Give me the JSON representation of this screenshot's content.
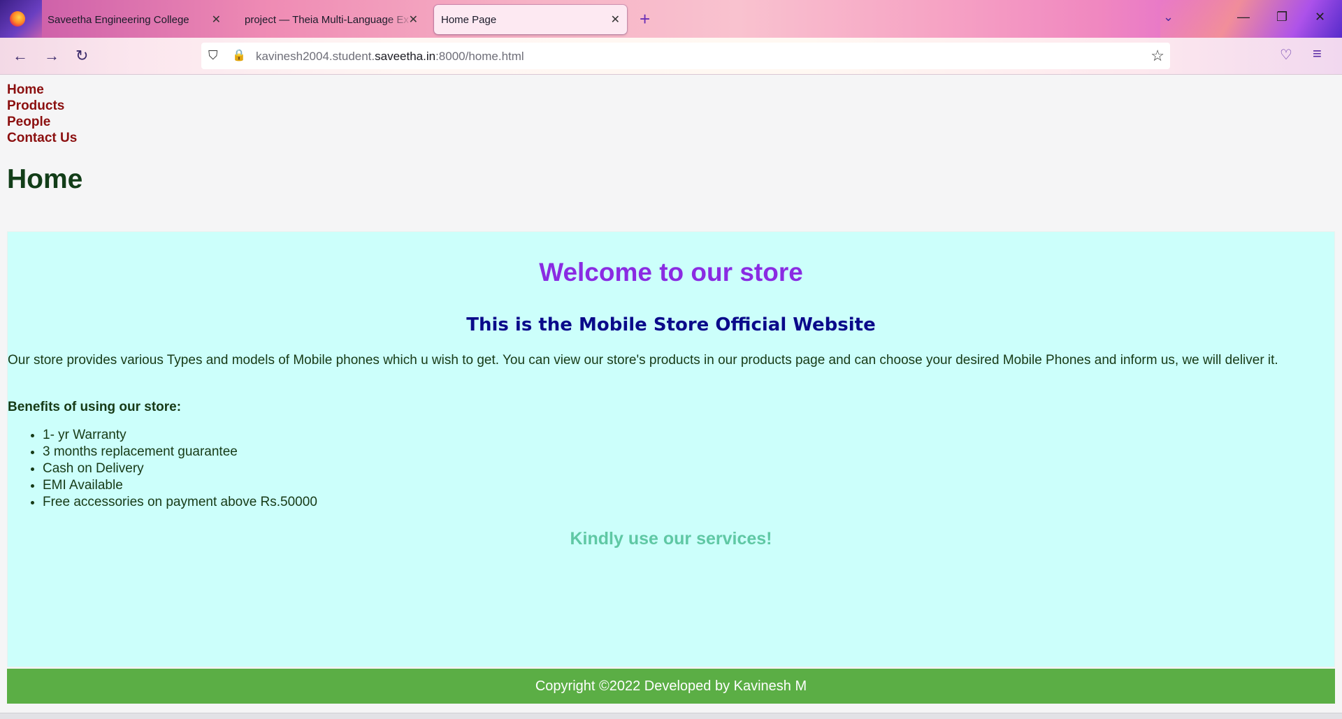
{
  "browser": {
    "tabs": [
      {
        "title": "Saveetha Engineering College",
        "active": false
      },
      {
        "title": "project — Theia Multi-Language Ex",
        "active": false
      },
      {
        "title": "Home Page",
        "active": true
      }
    ],
    "url": {
      "prefix": "kavinesh2004.student.",
      "domain": "saveetha.in",
      "suffix": ":8000/home.html"
    },
    "icons": {
      "back": "←",
      "forward": "→",
      "reload": "↻",
      "shield": "⛉",
      "lock": "🔒",
      "star": "☆",
      "pocket": "♡",
      "menu": "≡",
      "new_tab": "+",
      "list_tabs": "⌄",
      "minimize": "—",
      "maximize": "❐",
      "close": "✕",
      "tab_close": "✕"
    }
  },
  "site": {
    "nav": [
      "Home",
      "Products",
      "People",
      "Contact Us"
    ],
    "heading": "Home",
    "welcome": "Welcome to our store",
    "subtitle": "This is the Mobile Store Official Website",
    "description": "Our store provides various Types and models of Mobile phones which u wish to get. You can view our store's products in our products page and can choose your desired Mobile Phones and inform us, we will deliver it.",
    "benefits_heading": "Benefits of using our store:",
    "benefits": [
      "1- yr Warranty",
      "3 months replacement guarantee",
      "Cash on Delivery",
      "EMI Available",
      "Free accessories on payment above Rs.50000"
    ],
    "closing": "Kindly use our services!",
    "footer": "Copyright ©2022 Developed by Kavinesh M"
  },
  "colors": {
    "nav_link": "#8b0f0f",
    "heading": "#123d18",
    "content_bg": "#ccfffb",
    "welcome": "#8a2be2",
    "subtitle": "#0a0a8a",
    "closing": "#5fc8a4",
    "footer_bg": "#5bae45"
  }
}
